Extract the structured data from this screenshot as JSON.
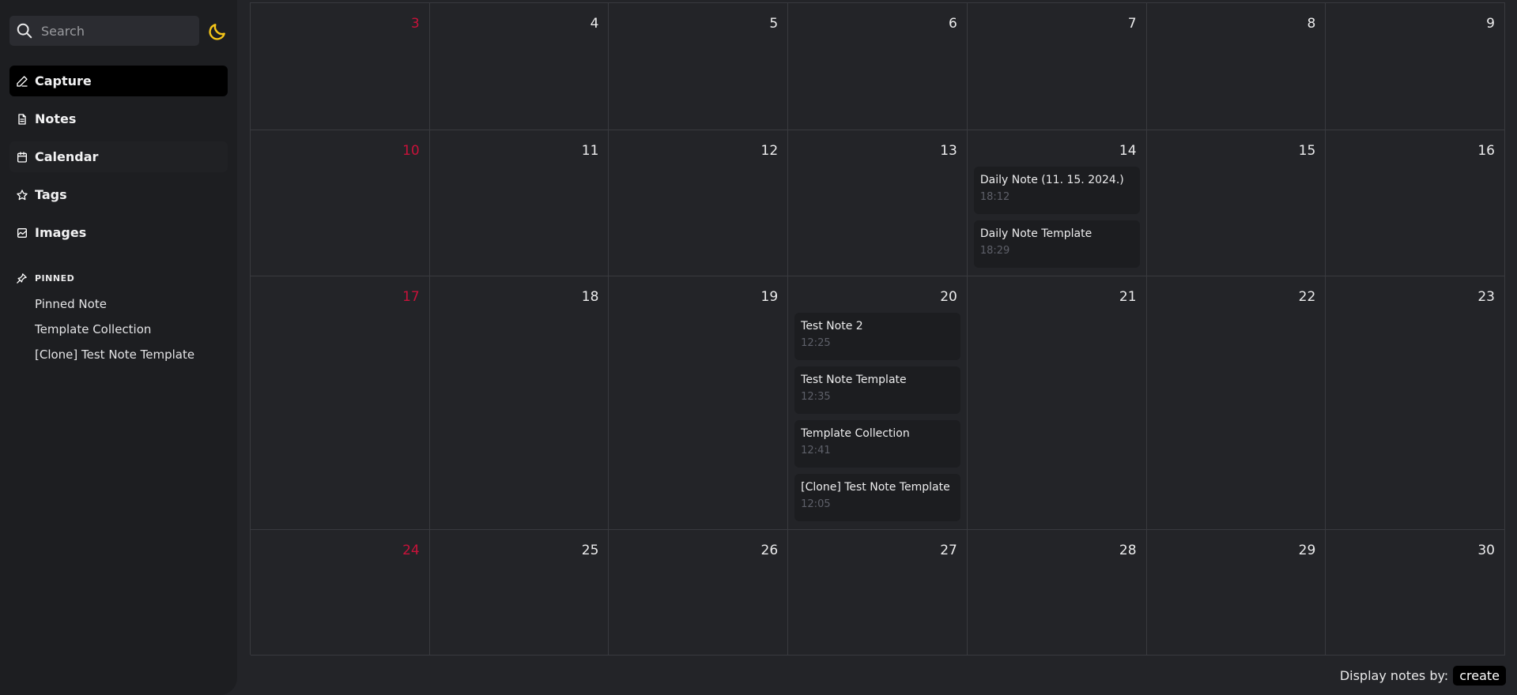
{
  "sidebar": {
    "search": {
      "placeholder": "Search"
    },
    "theme_icon": "moon-icon",
    "nav": [
      {
        "label": "Capture",
        "icon": "pencil-icon"
      },
      {
        "label": "Notes",
        "icon": "document-icon"
      },
      {
        "label": "Calendar",
        "icon": "calendar-icon"
      },
      {
        "label": "Tags",
        "icon": "star-icon"
      },
      {
        "label": "Images",
        "icon": "image-icon"
      }
    ],
    "pinned": {
      "heading": "PINNED",
      "items": [
        "Pinned Note",
        "Template Collection",
        "[Clone] Test Note Template"
      ]
    }
  },
  "calendar": {
    "weeks": [
      {
        "days": [
          {
            "day": "3",
            "notes": []
          },
          {
            "day": "4",
            "notes": []
          },
          {
            "day": "5",
            "notes": []
          },
          {
            "day": "6",
            "notes": []
          },
          {
            "day": "7",
            "notes": []
          },
          {
            "day": "8",
            "notes": []
          },
          {
            "day": "9",
            "notes": []
          }
        ]
      },
      {
        "days": [
          {
            "day": "10",
            "notes": []
          },
          {
            "day": "11",
            "notes": []
          },
          {
            "day": "12",
            "notes": []
          },
          {
            "day": "13",
            "notes": []
          },
          {
            "day": "14",
            "notes": [
              {
                "title": "Daily Note (11. 15. 2024.)",
                "time": "18:12"
              },
              {
                "title": "Daily Note Template",
                "time": "18:29"
              }
            ]
          },
          {
            "day": "15",
            "notes": []
          },
          {
            "day": "16",
            "notes": []
          }
        ]
      },
      {
        "days": [
          {
            "day": "17",
            "notes": []
          },
          {
            "day": "18",
            "notes": []
          },
          {
            "day": "19",
            "notes": []
          },
          {
            "day": "20",
            "notes": [
              {
                "title": "Test Note 2",
                "time": "12:25"
              },
              {
                "title": "Test Note Template",
                "time": "12:35"
              },
              {
                "title": "Template Collection",
                "time": "12:41"
              },
              {
                "title": "[Clone] Test Note Template",
                "time": "12:05"
              }
            ]
          },
          {
            "day": "21",
            "notes": []
          },
          {
            "day": "22",
            "notes": []
          },
          {
            "day": "23",
            "notes": []
          }
        ]
      },
      {
        "days": [
          {
            "day": "24",
            "notes": []
          },
          {
            "day": "25",
            "notes": []
          },
          {
            "day": "26",
            "notes": []
          },
          {
            "day": "27",
            "notes": []
          },
          {
            "day": "28",
            "notes": []
          },
          {
            "day": "29",
            "notes": []
          },
          {
            "day": "30",
            "notes": []
          }
        ]
      }
    ]
  },
  "footer": {
    "label": "Display notes by:",
    "value": "create"
  },
  "colors": {
    "accent": "#f5c518",
    "sunday": "#c8123a",
    "background": "#232428",
    "sidebar": "#1d1e21"
  }
}
